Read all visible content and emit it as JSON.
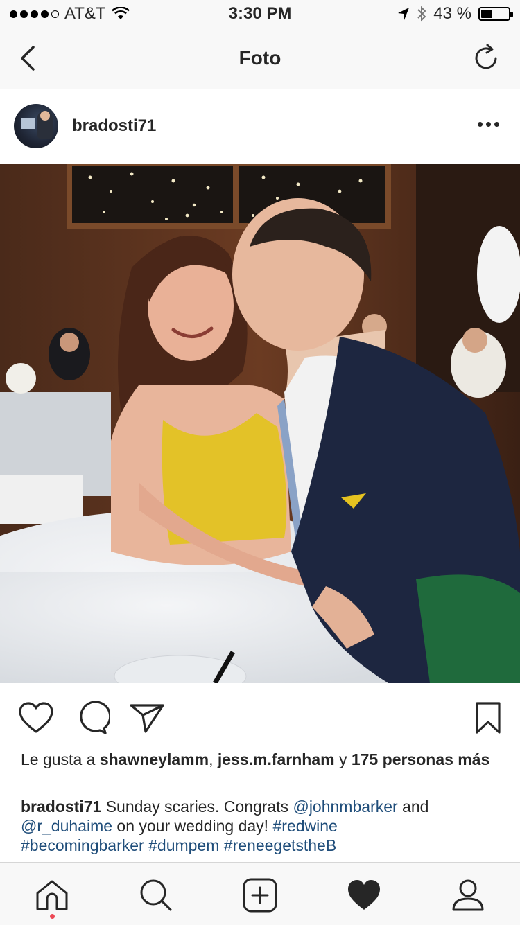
{
  "status_bar": {
    "carrier": "AT&T",
    "time": "3:30 PM",
    "battery_percent": "43 %",
    "battery_level": 0.43
  },
  "nav": {
    "title": "Foto"
  },
  "post": {
    "username": "bradosti71",
    "likes": {
      "prefix": "Le gusta a ",
      "user1": "shawneylamm",
      "sep": ", ",
      "user2": "jess.m.farnham",
      "conj": " y ",
      "others": "175 personas más"
    },
    "caption": {
      "author": "bradosti71",
      "t1": " Sunday scaries. Congrats ",
      "mention1": "@johnmbarker",
      "t2": " and ",
      "mention2": "@r_duhaime",
      "t3": " on your wedding day! ",
      "tag1": "#redwine",
      "tag2": "#becomingbarker",
      "tag3": "#dumpem",
      "tag4": "#reneegetstheB"
    }
  },
  "colors": {
    "link": "#1f4d7a",
    "text": "#262626",
    "notification_dot": "#ed4956"
  },
  "icons": {
    "nav": [
      "back-chevron-icon",
      "refresh-icon"
    ],
    "actions": [
      "heart-outline-icon",
      "comment-icon",
      "send-icon",
      "bookmark-icon"
    ],
    "tabs": [
      "home-icon",
      "search-icon",
      "add-post-icon",
      "activity-heart-icon",
      "profile-icon"
    ]
  }
}
